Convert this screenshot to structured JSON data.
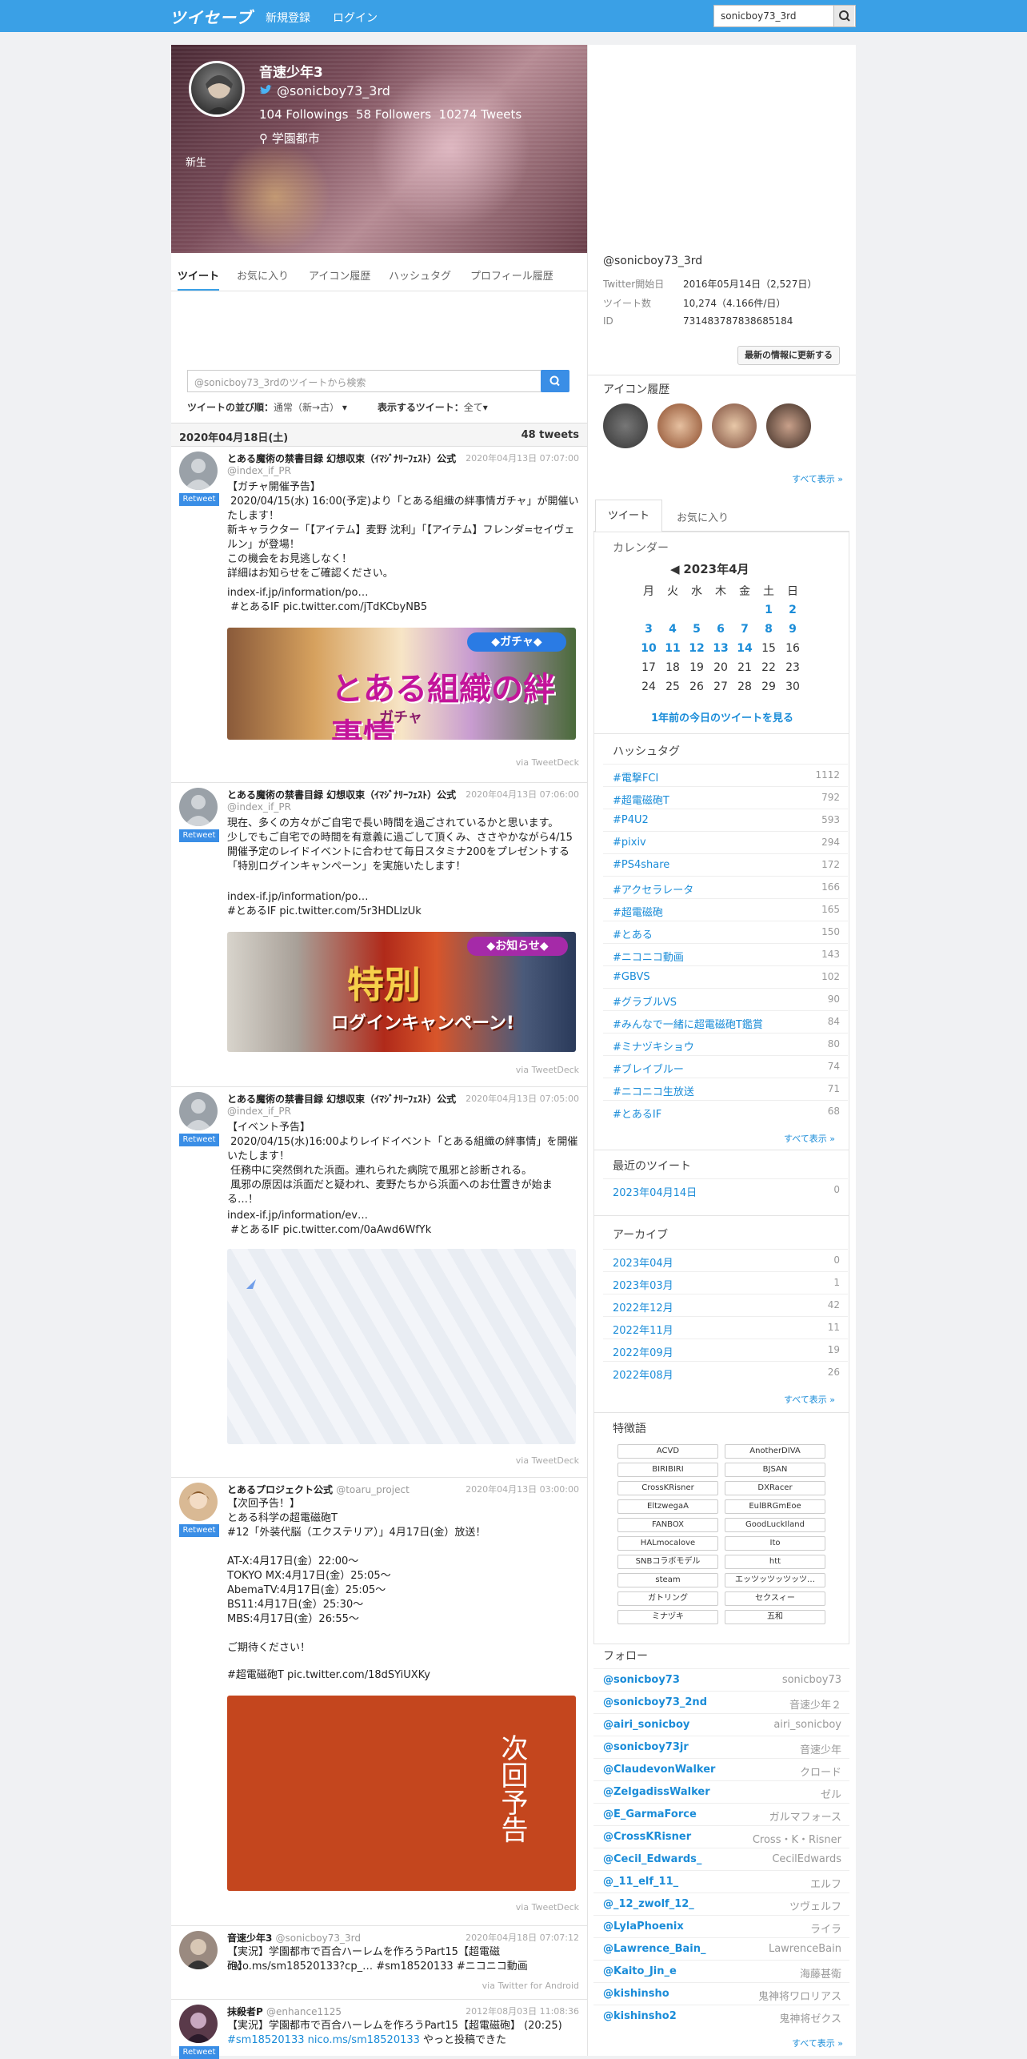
{
  "nav": {
    "logo": "ツイセーブ",
    "signup": "新規登録",
    "login": "ログイン",
    "search_value": "sonicboy73_3rd"
  },
  "profile": {
    "name": "音速少年3",
    "handle": "@sonicboy73_3rd",
    "stats": "104 Followings  58 Followers  10274 Tweets",
    "location": "学園都市",
    "bio": "新生"
  },
  "tabs": [
    "ツイート",
    "お気に入り",
    "アイコン履歴",
    "ハッシュタグ",
    "プロフィール履歴"
  ],
  "tweet_search": {
    "placeholder": "@sonicboy73_3rdのツイートから検索",
    "sort_label": "ツイートの並び順：",
    "sort_value": "通常（新→古）",
    "show_label": "表示するツイート：",
    "show_value": "全て"
  },
  "daybar": {
    "date": "2020年04月18日(土)",
    "count": "48 tweets"
  },
  "tweets": [
    {
      "name": "とある魔術の禁書目録 幻想収束（ｲﾏｼﾞﾅﾘｰﾌｪｽﾄ）公式",
      "handle": "@index_if_PR",
      "time": "2020年04月13日 07:07:00",
      "rt": "Retweet",
      "body": "【ガチャ開催予告】\n 2020/04/15(水) 16:00(予定)より「とある組織の絆事情ガチャ」が開催いたします！\n新キャラクター「【アイテム】麦野 沈利」「【アイテム】フレンダ=セイヴェルン」が登場！\nこの機会をお見逃しなく！\n詳細はお知らせをご確認ください。",
      "link1": "index-if.jp/information/po…",
      "link2": " #とあるIF pic.twitter.com/jTdKCbyNB5",
      "img_title": "とある組織の絆事情",
      "img_sub": "ガチャ",
      "img_badge": "◆ガチャ◆",
      "via": "via TweetDeck"
    },
    {
      "name": "とある魔術の禁書目録 幻想収束（ｲﾏｼﾞﾅﾘｰﾌｪｽﾄ）公式",
      "handle": "@index_if_PR",
      "time": "2020年04月13日 07:06:00",
      "rt": "Retweet",
      "body": "現在、多くの方々がご自宅で長い時間を過ごされているかと思います。\n少しでもご自宅での時間を有意義に過ごして頂くみ、ささやかながら4/15開催予定のレイドイベントに合わせて毎日スタミナ200をプレゼントする「特別ログインキャンペーン」を実施いたします！",
      "link1": "index-if.jp/information/po…",
      "link2": "#とあるIF pic.twitter.com/5r3HDLlzUk",
      "img_title": "特別",
      "img_sub": "ログインキャンペーン!",
      "img_badge": "◆お知らせ◆",
      "via": "via TweetDeck"
    },
    {
      "name": "とある魔術の禁書目録 幻想収束（ｲﾏｼﾞﾅﾘｰﾌｪｽﾄ）公式",
      "handle": "@index_if_PR",
      "time": "2020年04月13日 07:05:00",
      "rt": "Retweet",
      "body": "【イベント予告】\n 2020/04/15(水)16:00よりレイドイベント「とある組織の絆事情」を開催いたします！\n 任務中に突然倒れた浜面。連れられた病院で風邪と診断される。\n 風邪の原因は浜面だと疑われ、麦野たちから浜面へのお仕置きが始まる…！",
      "link1": "index-if.jp/information/ev…",
      "link2": " #とあるIF pic.twitter.com/0aAwd6WfYk",
      "via": "via TweetDeck"
    },
    {
      "name": "とあるプロジェクト公式",
      "handle": "@toaru_project",
      "time": "2020年04月13日 03:00:00",
      "rt": "Retweet",
      "body": "【次回予告！】\nとある科学の超電磁砲T\n#12「外装代脳（エクステリア）」4月17日(金）放送！\n\nAT-X:4月17日(金）22:00～\nTOKYO MX:4月17日(金）25:05～\nAbemaTV:4月17日(金）25:05～\nBS11:4月17日(金）25:30～\nMBS:4月17日(金）26:55～\n\nご期待ください！",
      "link2": "#超電磁砲T pic.twitter.com/18dSYiUXKy",
      "img_title": "次回予告",
      "via": "via TweetDeck"
    },
    {
      "name": "音速少年3",
      "handle": "@sonicboy73_3rd",
      "time": "2020年04月18日 07:07:12",
      "body": "【実況】学園都市で百合ハーレムを作ろうPart15【超電磁砲】 ",
      "link1": "nico.ms/sm18520133?cp_… #sm18520133 #ニコニコ動画",
      "via": "via Twitter for Android"
    },
    {
      "name": "抹殺者P",
      "handle": "@enhance1125",
      "time": "2012年08月03日 11:08:36",
      "rt": "Retweet",
      "body": "【実況】学園都市で百合ハーレムを作ろうPart15【超電磁砲】 (20:25) ",
      "link1": "#sm18520133 nico.ms/sm18520133",
      "body_tail": " やっと投稿できた"
    }
  ],
  "info": {
    "handle": "@sonicboy73_3rd",
    "rows": [
      {
        "k": "Twitter開始日",
        "v": "2016年05月14日（2,527日）"
      },
      {
        "k": "ツイート数",
        "v": "10,274（4.166件/日）"
      },
      {
        "k": "ID",
        "v": "731483787838685184"
      }
    ],
    "update": "最新の情報に更新する"
  },
  "icon_history": {
    "title": "アイコン履歴",
    "more": "すべて表示 »"
  },
  "rtabs": [
    "ツイート",
    "お気に入り"
  ],
  "calendar": {
    "title": "カレンダー",
    "month": "2023年4月",
    "prev": "◀",
    "dow": [
      "月",
      "火",
      "水",
      "木",
      "金",
      "土",
      "日"
    ],
    "weeks": [
      [
        "",
        "",
        "",
        "",
        "",
        "1",
        "2"
      ],
      [
        "3",
        "4",
        "5",
        "6",
        "7",
        "8",
        "9"
      ],
      [
        "10",
        "11",
        "12",
        "13",
        "14",
        "15",
        "16"
      ],
      [
        "17",
        "18",
        "19",
        "20",
        "21",
        "22",
        "23"
      ],
      [
        "24",
        "25",
        "26",
        "27",
        "28",
        "29",
        "30"
      ]
    ],
    "linked": [
      "1",
      "2",
      "3",
      "4",
      "5",
      "6",
      "7",
      "8",
      "9",
      "10",
      "11",
      "12",
      "13",
      "14"
    ],
    "year_ago": "1年前の今日のツイートを見る"
  },
  "hashtags": {
    "title": "ハッシュタグ",
    "items": [
      [
        "#電撃FCI",
        "1112"
      ],
      [
        "#超電磁砲T",
        "792"
      ],
      [
        "#P4U2",
        "593"
      ],
      [
        "#pixiv",
        "294"
      ],
      [
        "#PS4share",
        "172"
      ],
      [
        "#アクセラレータ",
        "166"
      ],
      [
        "#超電磁砲",
        "165"
      ],
      [
        "#とある",
        "150"
      ],
      [
        "#ニコニコ動画",
        "143"
      ],
      [
        "#GBVS",
        "102"
      ],
      [
        "#グラブルVS",
        "90"
      ],
      [
        "#みんなで一緒に超電磁砲T鑑賞",
        "84"
      ],
      [
        "#ミナヅキショウ",
        "80"
      ],
      [
        "#ブレイブルー",
        "74"
      ],
      [
        "#ニコニコ生放送",
        "71"
      ],
      [
        "#とあるIF",
        "68"
      ]
    ],
    "more": "すべて表示 »"
  },
  "recent": {
    "title": "最近のツイート",
    "items": [
      [
        "2023年04月14日",
        "0"
      ]
    ]
  },
  "archive": {
    "title": "アーカイブ",
    "items": [
      [
        "2023年04月",
        "0"
      ],
      [
        "2023年03月",
        "1"
      ],
      [
        "2022年12月",
        "42"
      ],
      [
        "2022年11月",
        "11"
      ],
      [
        "2022年09月",
        "19"
      ],
      [
        "2022年08月",
        "26"
      ]
    ],
    "more": "すべて表示 »"
  },
  "words": {
    "title": "特徴語",
    "items": [
      "ACVD",
      "AnotherDIVA",
      "BIRIBIRI",
      "BJSAN",
      "CrossKRisner",
      "DXRacer",
      "EltzwegaA",
      "EulBRGmEoe",
      "FANBOX",
      "GoodLuckIland",
      "HALmocalove",
      "Ito",
      "SNBコラボモデル",
      "htt",
      "steam",
      "エッツッツッツッツ…",
      "ガトリング",
      "セクスィー",
      "ミナヅキ",
      "五和"
    ]
  },
  "follow": {
    "title": "フォロー",
    "items": [
      [
        "@sonicboy73",
        "sonicboy73"
      ],
      [
        "@sonicboy73_2nd",
        "音速少年２"
      ],
      [
        "@airi_sonicboy",
        "airi_sonicboy"
      ],
      [
        "@sonicboy73jr",
        "音速少年"
      ],
      [
        "@ClaudevonWalker",
        "クロード"
      ],
      [
        "@ZelgadissWalker",
        "ゼル"
      ],
      [
        "@E_GarmaForce",
        "ガルマフォース"
      ],
      [
        "@CrossKRisner",
        "Cross・K・Risner"
      ],
      [
        "@Cecil_Edwards_",
        "CecilEdwards"
      ],
      [
        "@_11_elf_11_",
        "エルフ"
      ],
      [
        "@_12_zwolf_12_",
        "ツヴェルフ"
      ],
      [
        "@LylaPhoenix",
        "ライラ"
      ],
      [
        "@Lawrence_Bain_",
        "LawrenceBain"
      ],
      [
        "@Kaito_Jin_e",
        "海藤甚衛"
      ],
      [
        "@kishinsho",
        "鬼神将ワロリアス"
      ],
      [
        "@kishinsho2",
        "鬼神将ゼクス"
      ]
    ],
    "more": "すべて表示 »"
  }
}
